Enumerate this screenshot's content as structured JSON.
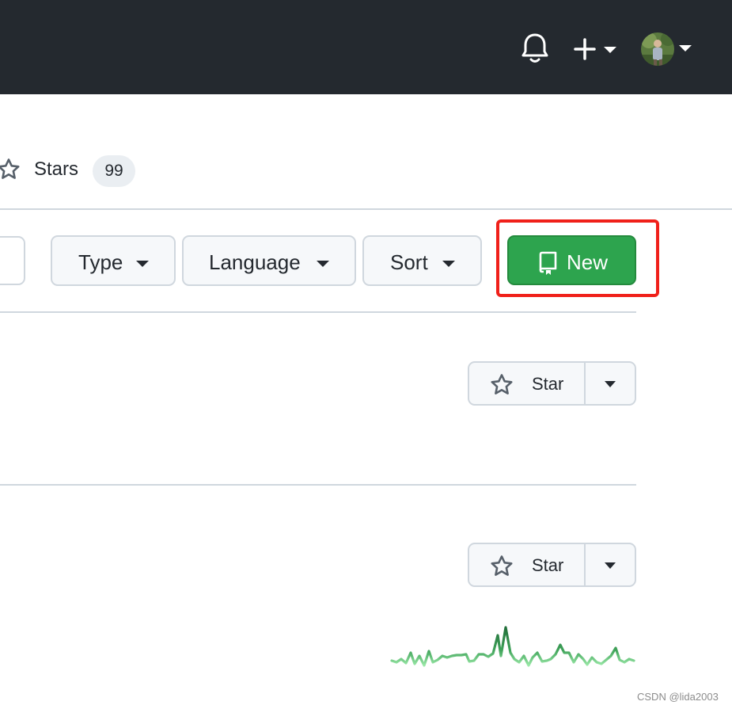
{
  "header": {
    "notifications_icon": "bell-icon",
    "create_icon": "plus-icon",
    "create_menu_icon": "caret-down-icon",
    "profile_icon": "avatar",
    "profile_menu_icon": "caret-down-icon"
  },
  "tabs": {
    "stars": {
      "label": "Stars",
      "count": "99",
      "icon": "star-icon"
    }
  },
  "filters": {
    "type_label": "Type",
    "language_label": "Language",
    "sort_label": "Sort",
    "caret_icon": "caret-down-icon"
  },
  "actions": {
    "new_label": "New",
    "new_icon": "repo-icon",
    "new_color": "#2da44e",
    "highlight_color": "#f0201a"
  },
  "repos": [
    {
      "star_label": "Star",
      "has_activity_graph": false
    },
    {
      "star_label": "Star",
      "has_activity_graph": true
    }
  ],
  "watermark": "CSDN @lida2003",
  "colors": {
    "header_bg": "#24292f",
    "border": "#d0d7de",
    "sparkline": "#2da44e"
  }
}
